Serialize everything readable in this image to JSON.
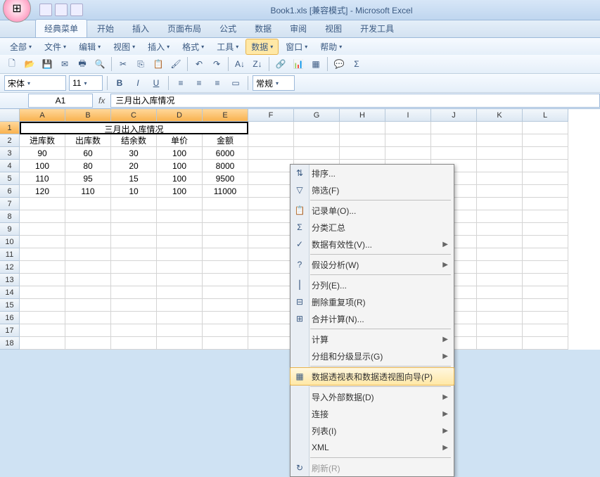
{
  "title": "Book1.xls [兼容模式] - Microsoft Excel",
  "tabs": [
    "经典菜单",
    "开始",
    "插入",
    "页面布局",
    "公式",
    "数据",
    "审阅",
    "视图",
    "开发工具"
  ],
  "active_tab": 0,
  "menubar": [
    "全部",
    "文件",
    "编辑",
    "视图",
    "插入",
    "格式",
    "工具",
    "数据",
    "窗口",
    "帮助"
  ],
  "open_menu": 7,
  "font": {
    "name": "宋体",
    "size": "11",
    "style": "常规"
  },
  "namebox": "A1",
  "formula": "三月出入库情况",
  "columns": [
    "A",
    "B",
    "C",
    "D",
    "E",
    "F",
    "G",
    "H",
    "I",
    "J",
    "K",
    "L"
  ],
  "row_count": 18,
  "merged_title": "三月出入库情况",
  "headers": [
    "进库数",
    "出库数",
    "结余数",
    "单价",
    "金额"
  ],
  "rows": [
    [
      "90",
      "60",
      "30",
      "100",
      "6000"
    ],
    [
      "100",
      "80",
      "20",
      "100",
      "8000"
    ],
    [
      "110",
      "95",
      "15",
      "100",
      "9500"
    ],
    [
      "120",
      "110",
      "10",
      "100",
      "11000"
    ]
  ],
  "dropdown": {
    "items": [
      {
        "icon": "⇅",
        "label": "排序...",
        "key": ""
      },
      {
        "icon": "▽",
        "label": "筛选",
        "key": "(F)"
      },
      {
        "sep": true
      },
      {
        "icon": "📋",
        "label": "记录单",
        "key": "(O)",
        "ell": true
      },
      {
        "icon": "Σ",
        "label": "分类汇总",
        "key": ""
      },
      {
        "icon": "✓",
        "label": "数据有效性",
        "key": "(V)",
        "ell": true,
        "sub": true
      },
      {
        "sep": true
      },
      {
        "icon": "?",
        "label": "假设分析",
        "key": "(W)",
        "sub": true
      },
      {
        "sep": true
      },
      {
        "icon": "⎮",
        "label": "分列",
        "key": "(E)",
        "ell": true
      },
      {
        "icon": "⊟",
        "label": "删除重复项",
        "key": "(R)"
      },
      {
        "icon": "⊞",
        "label": "合并计算",
        "key": "(N)",
        "ell": true
      },
      {
        "sep": true
      },
      {
        "icon": "",
        "label": "计算",
        "key": "",
        "sub": true
      },
      {
        "icon": "",
        "label": "分组和分级显示",
        "key": "(G)",
        "sub": true
      },
      {
        "sep": true
      },
      {
        "icon": "▦",
        "label": "数据透视表和数据透视图向导",
        "key": "(P)",
        "hl": true
      },
      {
        "sep": true
      },
      {
        "icon": "",
        "label": "导入外部数据",
        "key": "(D)",
        "sub": true
      },
      {
        "icon": "",
        "label": "连接",
        "key": "",
        "sub": true
      },
      {
        "icon": "",
        "label": "列表",
        "key": "(I)",
        "sub": true
      },
      {
        "icon": "",
        "label": "XML",
        "key": "",
        "sub": true
      },
      {
        "sep": true
      },
      {
        "icon": "↻",
        "label": "刷新",
        "key": "(R)",
        "disabled": true
      }
    ]
  },
  "chart_data": {
    "type": "table",
    "title": "三月出入库情况",
    "columns": [
      "进库数",
      "出库数",
      "结余数",
      "单价",
      "金额"
    ],
    "rows": [
      [
        90,
        60,
        30,
        100,
        6000
      ],
      [
        100,
        80,
        20,
        100,
        8000
      ],
      [
        110,
        95,
        15,
        100,
        9500
      ],
      [
        120,
        110,
        10,
        100,
        11000
      ]
    ]
  }
}
